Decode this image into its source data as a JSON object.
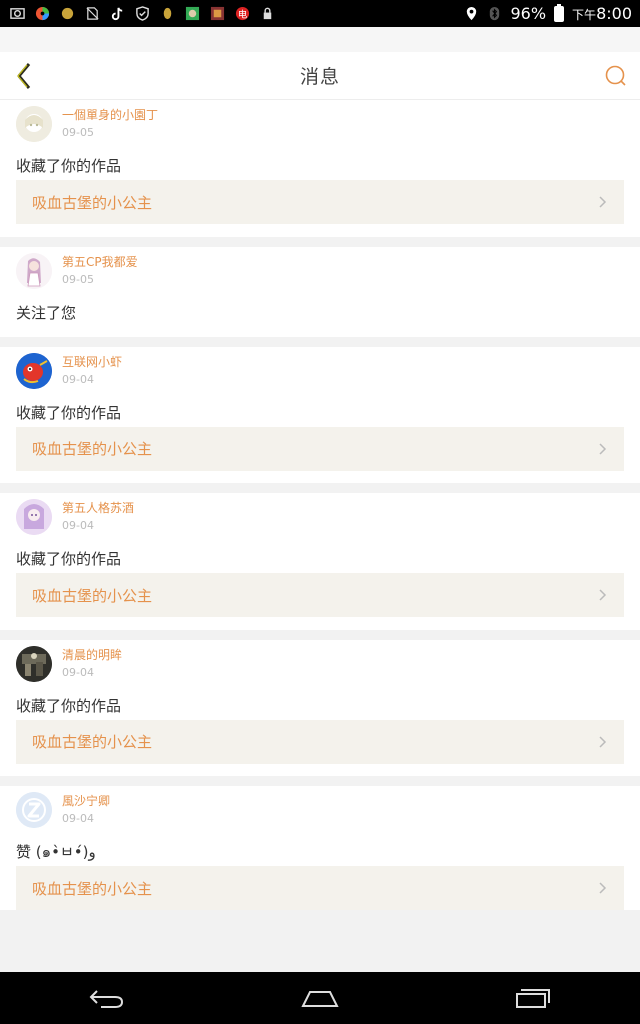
{
  "status_bar": {
    "icons": [
      "photo-icon",
      "pinwheel-icon",
      "dot-icon",
      "no-sim-icon",
      "tiktok-icon",
      "shield-icon",
      "leaf-icon",
      "game-icon",
      "game2-icon",
      "app-icon",
      "lock-icon"
    ],
    "battery": "96%",
    "ampm": "下午",
    "time": "8:00"
  },
  "header": {
    "title": "消息",
    "back_icon": "chevron-left-icon",
    "search_icon": "search-icon",
    "accent_color": "#e5924c"
  },
  "items": [
    {
      "user": "一個單身的小園丁",
      "date": "09-05",
      "action": "收藏了你的作品",
      "link": "吸血古堡的小公主",
      "avatar": "avatar-anime-white"
    },
    {
      "user": "第五CP我都爱",
      "date": "09-05",
      "action": "关注了您",
      "link": "",
      "avatar": "avatar-anime-girl"
    },
    {
      "user": "互联网小虾",
      "date": "09-04",
      "action": "收藏了你的作品",
      "link": "吸血古堡的小公主",
      "avatar": "avatar-shrimp"
    },
    {
      "user": "第五人格苏酒",
      "date": "09-04",
      "action": "收藏了你的作品",
      "link": "吸血古堡的小公主",
      "avatar": "avatar-anime-purple"
    },
    {
      "user": "清晨的明眸",
      "date": "09-04",
      "action": "收藏了你的作品",
      "link": "吸血古堡的小公主",
      "avatar": "avatar-photo"
    },
    {
      "user": "風沙宁卿",
      "date": "09-04",
      "action": "赞 (๑•̀ㅂ•́)و",
      "link": "吸血古堡的小公主",
      "avatar": "avatar-default"
    }
  ],
  "nav_bar": {
    "back": "nav-back-icon",
    "home": "nav-home-icon",
    "recents": "nav-recents-icon"
  }
}
